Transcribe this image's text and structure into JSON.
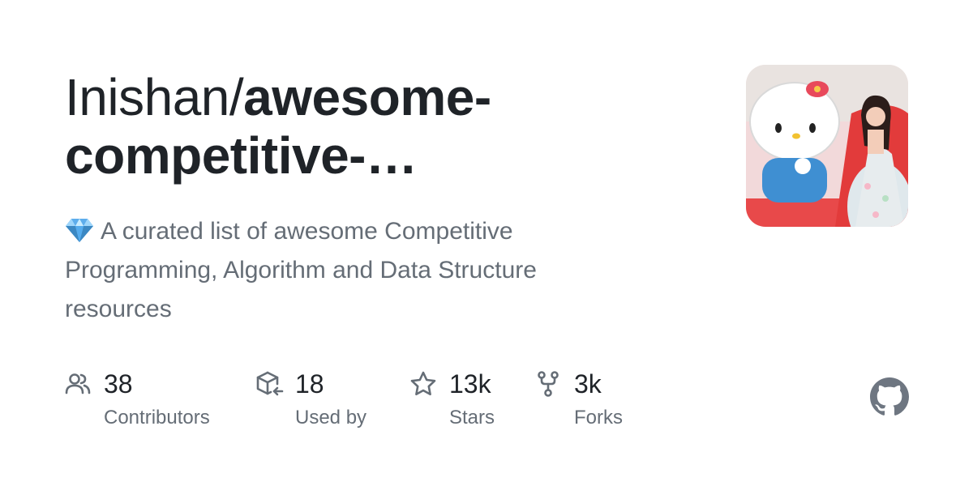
{
  "repo": {
    "owner": "Inishan/",
    "name": "awesome-competitive-…",
    "description": "A curated list of awesome Competitive Programming, Algorithm and Data Structure resources",
    "description_icon": "gem-emoji-icon"
  },
  "avatar": {
    "alt": "owner-avatar"
  },
  "stats": [
    {
      "value": "38",
      "label": "Contributors",
      "icon": "people-icon"
    },
    {
      "value": "18",
      "label": "Used by",
      "icon": "package-dependents-icon"
    },
    {
      "value": "13k",
      "label": "Stars",
      "icon": "star-icon"
    },
    {
      "value": "3k",
      "label": "Forks",
      "icon": "fork-icon"
    }
  ],
  "brand": {
    "icon": "github-logo-icon"
  },
  "colors": {
    "text_primary": "#1f2328",
    "text_secondary": "#656d76",
    "icon": "#656d76",
    "github_logo": "#6e7681"
  }
}
